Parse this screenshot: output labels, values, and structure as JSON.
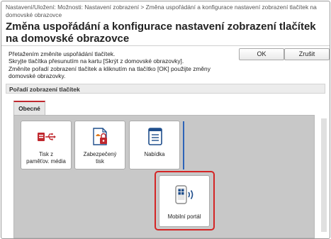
{
  "breadcrumb": "Nastavení/Uložení: Možnosti: Nastavení zobrazení > Změna uspořádání a konfigurace nastavení zobrazení tlačítek na domovské obrazovce",
  "page_title": "Změna uspořádání a konfigurace nastavení zobrazení tlačítek na domovské obrazovce",
  "instructions": [
    "Přetažením změníte uspořádání tlačítek.",
    "Skryjte tlačítka přesunutím na kartu [Skrýt z domovské obrazovky].",
    "Změníte pořadí zobrazení tlačítek a kliknutím na tlačítko [OK] použijte změny",
    "domovské obrazovky."
  ],
  "buttons": {
    "ok": "OK",
    "cancel": "Zrušit"
  },
  "section_title": "Pořadí zobrazení tlačítek",
  "tabs": [
    {
      "label": "Obecné",
      "active": true
    }
  ],
  "tiles": [
    {
      "label_lines": [
        "Tisk z",
        "paměťov. média"
      ],
      "icon": "usb-media-icon"
    },
    {
      "label_lines": [
        "Zabezpečený",
        "tisk"
      ],
      "icon": "secure-print-icon"
    },
    {
      "label_lines": [
        "Nabídka"
      ],
      "icon": "menu-list-icon"
    },
    {
      "label_lines": [
        "Mobilní portál"
      ],
      "icon": "mobile-portal-icon",
      "selected": true
    }
  ],
  "colors": {
    "accent": "#c0282e",
    "icon_red": "#c0282e",
    "icon_orange": "#e07a1e",
    "icon_blue": "#1f4e8c",
    "selection": "#d42525",
    "drop_indicator": "#2e64b8"
  }
}
